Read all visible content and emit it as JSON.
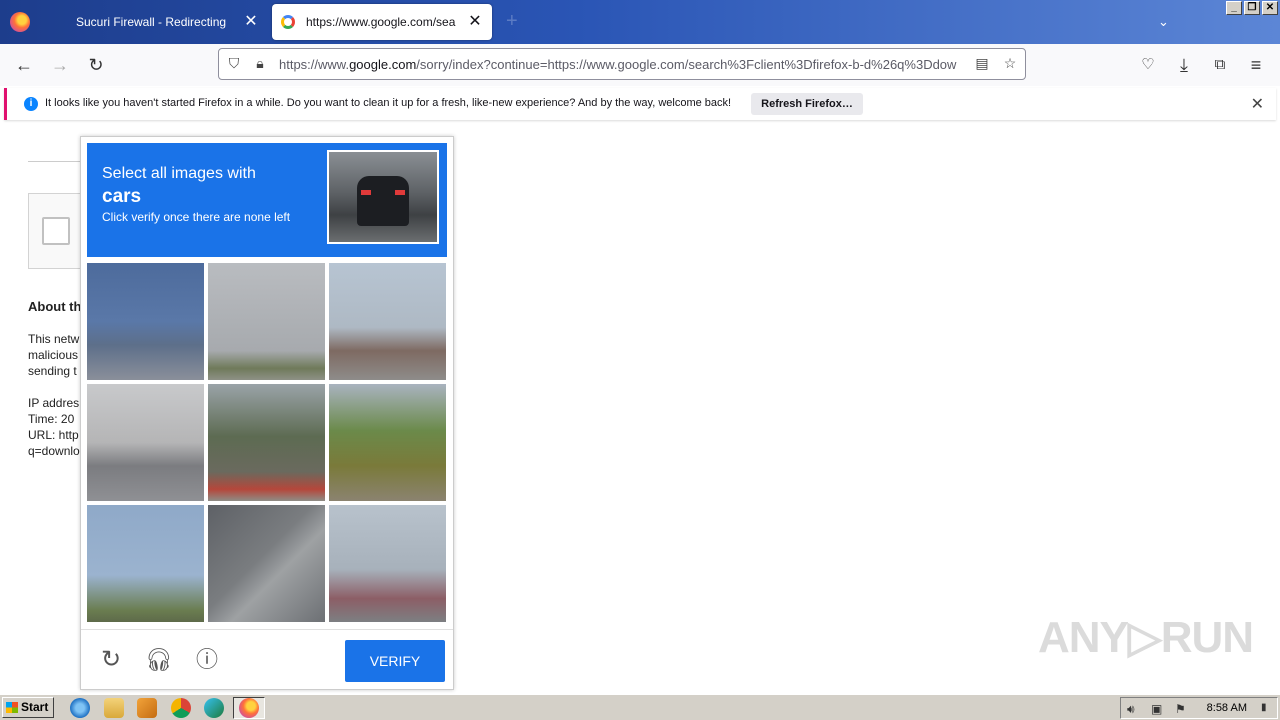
{
  "browser": {
    "tabs": [
      {
        "label": "Sucuri Firewall - Redirecting..."
      },
      {
        "label": "https://www.google.com/search?c"
      }
    ],
    "new_tab_glyph": "+",
    "close_glyph": "✕",
    "url": {
      "prefix": "https://www.",
      "host": "google.com",
      "rest": "/sorry/index?continue=https://www.google.com/search%3Fclient%3Dfirefox-b-d%26q%3Ddow"
    },
    "window_buttons": [
      "_",
      "❐",
      "✕"
    ]
  },
  "notification": {
    "text": "It looks like you haven't started Firefox in a while. Do you want to clean it up for a fresh, like-new experience? And by the way, welcome back!",
    "button": "Refresh Firefox…",
    "info_glyph": "i"
  },
  "page": {
    "lines": [
      "About th",
      "This netw",
      "malicious",
      "sending t",
      "IP addres",
      "Time: 20",
      "URL: http",
      "q=downlo"
    ]
  },
  "captcha": {
    "line1": "Select all images with",
    "target": "cars",
    "line3": "Click verify once there are none left",
    "verify_label": "VERIFY",
    "tiles": [
      {
        "name": "road-sign-car",
        "bg": "linear-gradient(180deg,#4d6b9c 0%,#5a78a8 50%,#5d6f8a 70%,#8a8f9a 100%)"
      },
      {
        "name": "sky-palm",
        "bg": "linear-gradient(180deg,#b9bcc0 0%,#a7aaae 75%,#6f7a5a 90%,#8e9186 100%)"
      },
      {
        "name": "intersection-traffic",
        "bg": "linear-gradient(180deg,#b7c4d2 0%,#aeb9c4 55%,#7e6a62 75%,#8e8c8a 100%)"
      },
      {
        "name": "street-cars",
        "bg": "linear-gradient(180deg,#c8c9cb 0%,#b5b5b6 50%,#7b7c80 70%,#8f9094 100%)"
      },
      {
        "name": "trees-boat",
        "bg": "linear-gradient(180deg,#9aa3a8 0%,#5d6b52 45%,#6a6a5e 75%,#b5473b 90%,#8e8d86 100%)"
      },
      {
        "name": "tree-traffic-light",
        "bg": "linear-gradient(180deg,#a9b3bf 0%,#6b8a4a 40%,#7a7a3a 70%,#8b8370 100%)"
      },
      {
        "name": "traffic-light-pole",
        "bg": "linear-gradient(180deg,#8fa9c8 0%,#9bb3cf 60%,#6a7d50 90%,#5e6a4a 100%)"
      },
      {
        "name": "roof-edge",
        "bg": "linear-gradient(135deg,#5e6166 0%,#7a7d80 45%,#9ea1a3 60%,#6d7074 100%)"
      },
      {
        "name": "palm-pole",
        "bg": "linear-gradient(180deg,#b8c2cc 0%,#a7b1bb 55%,#8c5e66 80%,#7d7f82 100%)"
      }
    ]
  },
  "watermark": "ANY▷RUN",
  "taskbar": {
    "start_label": "Start",
    "clock": "8:58 AM"
  }
}
